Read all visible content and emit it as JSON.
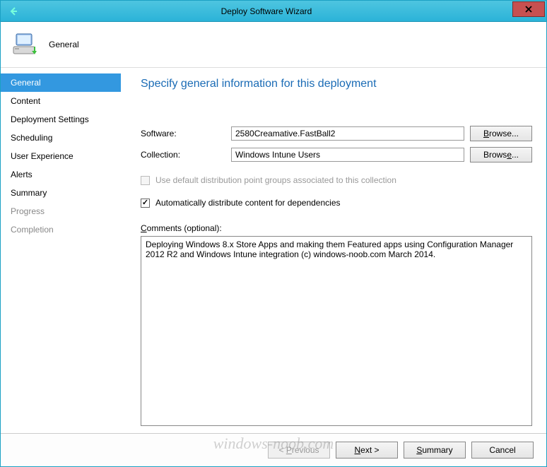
{
  "titlebar": {
    "title": "Deploy Software Wizard"
  },
  "header": {
    "label": "General"
  },
  "sidebar": {
    "items": [
      {
        "label": "General",
        "state": "selected"
      },
      {
        "label": "Content",
        "state": "normal"
      },
      {
        "label": "Deployment Settings",
        "state": "normal"
      },
      {
        "label": "Scheduling",
        "state": "normal"
      },
      {
        "label": "User Experience",
        "state": "normal"
      },
      {
        "label": "Alerts",
        "state": "normal"
      },
      {
        "label": "Summary",
        "state": "normal"
      },
      {
        "label": "Progress",
        "state": "disabled"
      },
      {
        "label": "Completion",
        "state": "disabled"
      }
    ]
  },
  "content": {
    "heading": "Specify general information for this deployment",
    "software_label": "Software:",
    "software_value": "2580Creamative.FastBall2",
    "collection_label": "Collection:",
    "collection_value": "Windows Intune Users",
    "browse_label": "Browse...",
    "chk_default_dp": "Use default distribution point groups associated to this collection",
    "chk_auto_distribute": "Automatically distribute content for dependencies",
    "comments_label": "Comments (optional):",
    "comments_value": "Deploying Windows 8.x Store Apps and making them Featured apps using Configuration Manager 2012 R2 and Windows Intune integration (c) windows-noob.com March 2014."
  },
  "footer": {
    "previous": "< Previous",
    "next": "Next >",
    "summary": "Summary",
    "cancel": "Cancel"
  },
  "watermark": "windows-noob.com"
}
